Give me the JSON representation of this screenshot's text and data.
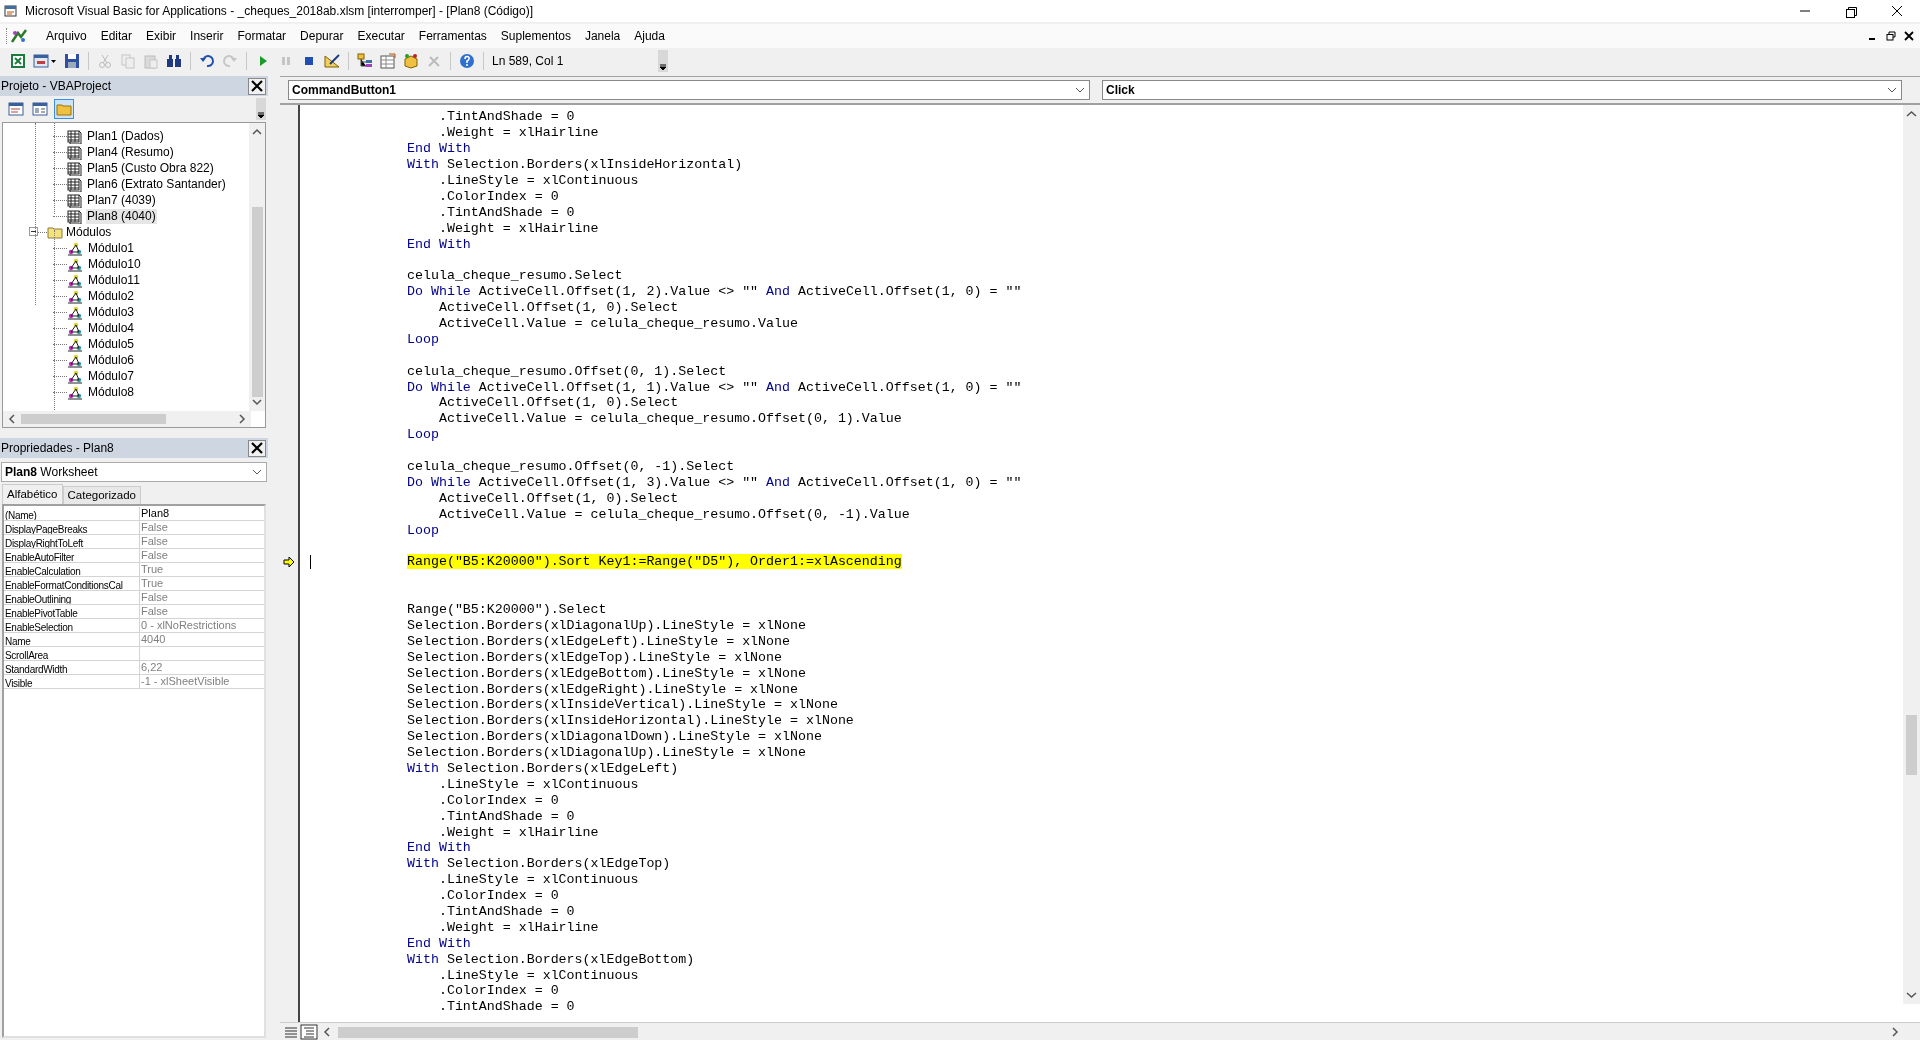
{
  "window": {
    "title": "Microsoft Visual Basic for Applications - _cheques_2018ab.xlsm [interromper] - [Plan8 (Código)]"
  },
  "menu": [
    "Arquivo",
    "Editar",
    "Exibir",
    "Inserir",
    "Formatar",
    "Depurar",
    "Executar",
    "Ferramentas",
    "Suplementos",
    "Janela",
    "Ajuda"
  ],
  "toolbar": {
    "buttons": [
      {
        "kind": "excel",
        "disabled": false
      },
      {
        "kind": "form",
        "disabled": false
      },
      {
        "kind": "save",
        "disabled": false
      },
      {
        "kind": "cut",
        "disabled": true
      },
      {
        "kind": "copy",
        "disabled": true
      },
      {
        "kind": "paste",
        "disabled": true
      },
      {
        "kind": "find",
        "disabled": false
      },
      {
        "kind": "undo",
        "disabled": false
      },
      {
        "kind": "redo",
        "disabled": true
      },
      {
        "kind": "run",
        "disabled": false
      },
      {
        "kind": "pause",
        "disabled": true
      },
      {
        "kind": "stop",
        "disabled": false
      },
      {
        "kind": "design",
        "disabled": false
      },
      {
        "kind": "project",
        "disabled": false
      },
      {
        "kind": "properties",
        "disabled": false
      },
      {
        "kind": "browser",
        "disabled": false
      },
      {
        "kind": "toolbox",
        "disabled": true
      },
      {
        "kind": "help",
        "disabled": false
      }
    ],
    "position": "Ln 589, Col 1"
  },
  "project_panel": {
    "title": "Projeto - VBAProject",
    "buttons": [
      {
        "kind": "view-code",
        "selected": false
      },
      {
        "kind": "view-object",
        "selected": false
      },
      {
        "kind": "toggle-folders",
        "selected": true
      }
    ],
    "tree": [
      {
        "label": "Plan1 (Dados)",
        "kind": "sheet",
        "selected": false
      },
      {
        "label": "Plan4 (Resumo)",
        "kind": "sheet",
        "selected": false
      },
      {
        "label": "Plan5 (Custo Obra 822)",
        "kind": "sheet",
        "selected": false
      },
      {
        "label": "Plan6 (Extrato Santander)",
        "kind": "sheet",
        "selected": false
      },
      {
        "label": "Plan7 (4039)",
        "kind": "sheet",
        "selected": false
      },
      {
        "label": "Plan8 (4040)",
        "kind": "sheet",
        "selected": true
      },
      {
        "label": "Módulos",
        "kind": "folder",
        "selected": false,
        "expanded": true,
        "children": [
          {
            "label": "Módulo1",
            "kind": "module",
            "selected": false
          },
          {
            "label": "Módulo10",
            "kind": "module",
            "selected": false
          },
          {
            "label": "Módulo11",
            "kind": "module",
            "selected": false
          },
          {
            "label": "Módulo2",
            "kind": "module",
            "selected": false
          },
          {
            "label": "Módulo3",
            "kind": "module",
            "selected": false
          },
          {
            "label": "Módulo4",
            "kind": "module",
            "selected": false
          },
          {
            "label": "Módulo5",
            "kind": "module",
            "selected": false
          },
          {
            "label": "Módulo6",
            "kind": "module",
            "selected": false
          },
          {
            "label": "Módulo7",
            "kind": "module",
            "selected": false
          },
          {
            "label": "Módulo8",
            "kind": "module",
            "selected": false
          }
        ]
      }
    ]
  },
  "properties_panel": {
    "title": "Propriedades - Plan8",
    "object": "**Plan8** Worksheet",
    "tabs": [
      {
        "label": "Alfabético",
        "selected": true
      },
      {
        "label": "Categorizado",
        "selected": false
      }
    ],
    "rows": [
      {
        "name": "(Name)",
        "value": "Plan8",
        "disabled": false
      },
      {
        "name": "DisplayPageBreaks",
        "value": "False",
        "disabled": true
      },
      {
        "name": "DisplayRightToLeft",
        "value": "False",
        "disabled": true
      },
      {
        "name": "EnableAutoFilter",
        "value": "False",
        "disabled": true
      },
      {
        "name": "EnableCalculation",
        "value": "True",
        "disabled": true
      },
      {
        "name": "EnableFormatConditionsCal",
        "value": "True",
        "disabled": true
      },
      {
        "name": "EnableOutlining",
        "value": "False",
        "disabled": true
      },
      {
        "name": "EnablePivotTable",
        "value": "False",
        "disabled": true
      },
      {
        "name": "EnableSelection",
        "value": "0 - xlNoRestrictions",
        "disabled": true
      },
      {
        "name": "Name",
        "value": "4040",
        "disabled": true
      },
      {
        "name": "ScrollArea"
      },
      {
        "name": "StandardWidth",
        "value": "6,22",
        "disabled": true
      },
      {
        "name": "Visible",
        "value": "-1 - xlSheetVisible",
        "disabled": true
      }
    ]
  },
  "code_window": {
    "object": "CommandButton1",
    "procedure": "Click",
    "lines": [
      {
        "current": false,
        "parts": [
          {
            "kind": "code",
            "text": "    .TintAndShade = 0"
          }
        ]
      },
      {
        "current": false,
        "parts": [
          {
            "kind": "code",
            "text": "    .Weight = xlHairline"
          }
        ]
      },
      {
        "current": false,
        "parts": [
          {
            "kind": "keyword",
            "text": "End With"
          }
        ]
      },
      {
        "current": false,
        "parts": [
          {
            "kind": "keyword",
            "text": "With"
          },
          {
            "kind": "code",
            "text": " Selection.Borders(xlInsideHorizontal)"
          }
        ]
      },
      {
        "current": false,
        "parts": [
          {
            "kind": "code",
            "text": "    .LineStyle = xlContinuous"
          }
        ]
      },
      {
        "current": false,
        "parts": [
          {
            "kind": "code",
            "text": "    .ColorIndex = 0"
          }
        ]
      },
      {
        "current": false,
        "parts": [
          {
            "kind": "code",
            "text": "    .TintAndShade = 0"
          }
        ]
      },
      {
        "current": false,
        "parts": [
          {
            "kind": "code",
            "text": "    .Weight = xlHairline"
          }
        ]
      },
      {
        "current": false,
        "parts": [
          {
            "kind": "keyword",
            "text": "End With"
          }
        ]
      },
      {
        "current": false
      },
      {
        "current": false,
        "parts": [
          {
            "kind": "code",
            "text": "celula_cheque_resumo.Select"
          }
        ]
      },
      {
        "current": false,
        "parts": [
          {
            "kind": "keyword",
            "text": "Do While"
          },
          {
            "kind": "code",
            "text": " ActiveCell.Offset(1, 2).Value <> \"\" "
          },
          {
            "kind": "keyword",
            "text": "And"
          },
          {
            "kind": "code",
            "text": " ActiveCell.Offset(1, 0) = \"\""
          }
        ]
      },
      {
        "current": false,
        "parts": [
          {
            "kind": "code",
            "text": "    ActiveCell.Offset(1, 0).Select"
          }
        ]
      },
      {
        "current": false,
        "parts": [
          {
            "kind": "code",
            "text": "    ActiveCell.Value = celula_cheque_resumo.Value"
          }
        ]
      },
      {
        "current": false,
        "parts": [
          {
            "kind": "keyword",
            "text": "Loop"
          }
        ]
      },
      {
        "current": false
      },
      {
        "current": false,
        "parts": [
          {
            "kind": "code",
            "text": "celula_cheque_resumo.Offset(0, 1).Select"
          }
        ]
      },
      {
        "current": false,
        "parts": [
          {
            "kind": "keyword",
            "text": "Do While"
          },
          {
            "kind": "code",
            "text": " ActiveCell.Offset(1, 1).Value <> \"\" "
          },
          {
            "kind": "keyword",
            "text": "And"
          },
          {
            "kind": "code",
            "text": " ActiveCell.Offset(1, 0) = \"\""
          }
        ]
      },
      {
        "current": false,
        "parts": [
          {
            "kind": "code",
            "text": "    ActiveCell.Offset(1, 0).Select"
          }
        ]
      },
      {
        "current": false,
        "parts": [
          {
            "kind": "code",
            "text": "    ActiveCell.Value = celula_cheque_resumo.Offset(0, 1).Value"
          }
        ]
      },
      {
        "current": false,
        "parts": [
          {
            "kind": "keyword",
            "text": "Loop"
          }
        ]
      },
      {
        "current": false
      },
      {
        "current": false,
        "parts": [
          {
            "kind": "code",
            "text": "celula_cheque_resumo.Offset(0, -1).Select"
          }
        ]
      },
      {
        "current": false,
        "parts": [
          {
            "kind": "keyword",
            "text": "Do While"
          },
          {
            "kind": "code",
            "text": " ActiveCell.Offset(1, 3).Value <> \"\" "
          },
          {
            "kind": "keyword",
            "text": "And"
          },
          {
            "kind": "code",
            "text": " ActiveCell.Offset(1, 0) = \"\""
          }
        ]
      },
      {
        "current": false,
        "parts": [
          {
            "kind": "code",
            "text": "    ActiveCell.Offset(1, 0).Select"
          }
        ]
      },
      {
        "current": false,
        "parts": [
          {
            "kind": "code",
            "text": "    ActiveCell.Value = celula_cheque_resumo.Offset(0, -1).Value"
          }
        ]
      },
      {
        "current": false,
        "parts": [
          {
            "kind": "keyword",
            "text": "Loop"
          }
        ]
      },
      {
        "current": false
      },
      {
        "current": true,
        "parts": [
          {
            "kind": "code",
            "text": "Range(\"B5:K20000\").Sort Key1:=Range(\"D5\"), Order1:=xlAscending"
          }
        ]
      },
      {
        "current": false
      },
      {
        "current": false
      },
      {
        "current": false,
        "parts": [
          {
            "kind": "code",
            "text": "Range(\"B5:K20000\").Select"
          }
        ]
      },
      {
        "current": false,
        "parts": [
          {
            "kind": "code",
            "text": "Selection.Borders(xlDiagonalUp).LineStyle = xlNone"
          }
        ]
      },
      {
        "current": false,
        "parts": [
          {
            "kind": "code",
            "text": "Selection.Borders(xlEdgeLeft).LineStyle = xlNone"
          }
        ]
      },
      {
        "current": false,
        "parts": [
          {
            "kind": "code",
            "text": "Selection.Borders(xlEdgeTop).LineStyle = xlNone"
          }
        ]
      },
      {
        "current": false,
        "parts": [
          {
            "kind": "code",
            "text": "Selection.Borders(xlEdgeBottom).LineStyle = xlNone"
          }
        ]
      },
      {
        "current": false,
        "parts": [
          {
            "kind": "code",
            "text": "Selection.Borders(xlEdgeRight).LineStyle = xlNone"
          }
        ]
      },
      {
        "current": false,
        "parts": [
          {
            "kind": "code",
            "text": "Selection.Borders(xlInsideVertical).LineStyle = xlNone"
          }
        ]
      },
      {
        "current": false,
        "parts": [
          {
            "kind": "code",
            "text": "Selection.Borders(xlInsideHorizontal).LineStyle = xlNone"
          }
        ]
      },
      {
        "current": false,
        "parts": [
          {
            "kind": "code",
            "text": "Selection.Borders(xlDiagonalDown).LineStyle = xlNone"
          }
        ]
      },
      {
        "current": false,
        "parts": [
          {
            "kind": "code",
            "text": "Selection.Borders(xlDiagonalUp).LineStyle = xlNone"
          }
        ]
      },
      {
        "current": false,
        "parts": [
          {
            "kind": "keyword",
            "text": "With"
          },
          {
            "kind": "code",
            "text": " Selection.Borders(xlEdgeLeft)"
          }
        ]
      },
      {
        "current": false,
        "parts": [
          {
            "kind": "code",
            "text": "    .LineStyle = xlContinuous"
          }
        ]
      },
      {
        "current": false,
        "parts": [
          {
            "kind": "code",
            "text": "    .ColorIndex = 0"
          }
        ]
      },
      {
        "current": false,
        "parts": [
          {
            "kind": "code",
            "text": "    .TintAndShade = 0"
          }
        ]
      },
      {
        "current": false,
        "parts": [
          {
            "kind": "code",
            "text": "    .Weight = xlHairline"
          }
        ]
      },
      {
        "current": false,
        "parts": [
          {
            "kind": "keyword",
            "text": "End With"
          }
        ]
      },
      {
        "current": false,
        "parts": [
          {
            "kind": "keyword",
            "text": "With"
          },
          {
            "kind": "code",
            "text": " Selection.Borders(xlEdgeTop)"
          }
        ]
      },
      {
        "current": false,
        "parts": [
          {
            "kind": "code",
            "text": "    .LineStyle = xlContinuous"
          }
        ]
      },
      {
        "current": false,
        "parts": [
          {
            "kind": "code",
            "text": "    .ColorIndex = 0"
          }
        ]
      },
      {
        "current": false,
        "parts": [
          {
            "kind": "code",
            "text": "    .TintAndShade = 0"
          }
        ]
      },
      {
        "current": false,
        "parts": [
          {
            "kind": "code",
            "text": "    .Weight = xlHairline"
          }
        ]
      },
      {
        "current": false,
        "parts": [
          {
            "kind": "keyword",
            "text": "End With"
          }
        ]
      },
      {
        "current": false,
        "parts": [
          {
            "kind": "keyword",
            "text": "With"
          },
          {
            "kind": "code",
            "text": " Selection.Borders(xlEdgeBottom)"
          }
        ]
      },
      {
        "current": false,
        "parts": [
          {
            "kind": "code",
            "text": "    .LineStyle = xlContinuous"
          }
        ]
      },
      {
        "current": false,
        "parts": [
          {
            "kind": "code",
            "text": "    .ColorIndex = 0"
          }
        ]
      },
      {
        "current": false,
        "parts": [
          {
            "kind": "code",
            "text": "    .TintAndShade = 0"
          }
        ]
      }
    ]
  }
}
